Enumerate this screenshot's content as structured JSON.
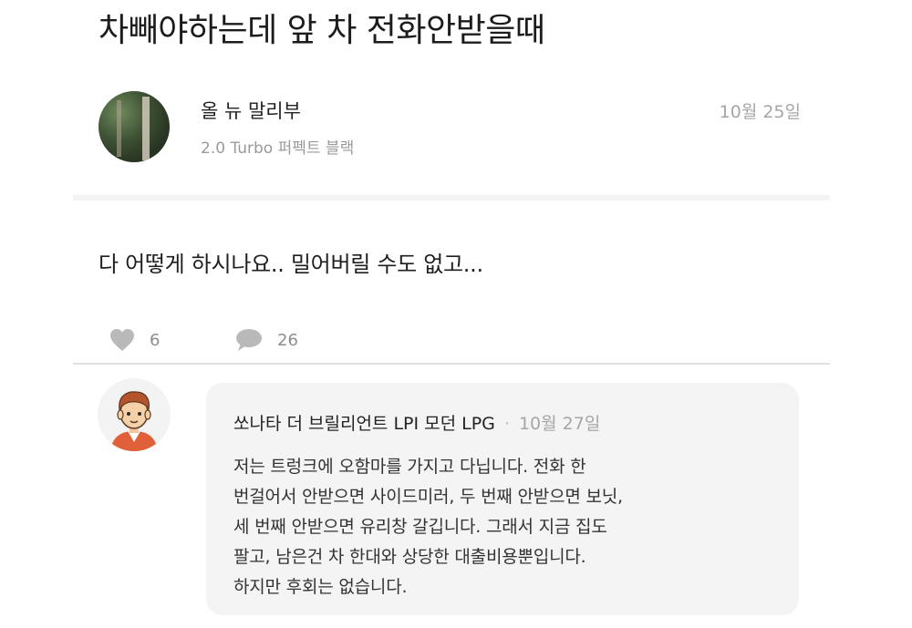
{
  "post": {
    "title": "차빼야하는데 앞 차 전화안받을때",
    "author": {
      "name": "올 뉴 말리부",
      "car": "2.0 Turbo 퍼펙트 블랙"
    },
    "date": "10월 25일",
    "body": "다 어떻게 하시나요.. 밀어버릴 수도 없고...",
    "likes": "6",
    "comments": "26"
  },
  "comment": {
    "author": "쏘나타 더 브릴리언트 LPI 모던 LPG",
    "separator": "·",
    "date": "10월 27일",
    "lines": [
      "저는 트렁크에 오함마를 가지고 다닙니다. 전화 한",
      "번걸어서 안받으면 사이드미러, 두 번째 안받으면 보닛,",
      "세 번째 안받으면 유리창 갈깁니다. 그래서 지금 집도",
      "팔고, 남은건 차 한대와 상당한 대출비용뿐입니다.",
      "하지만 후회는 없습니다."
    ]
  },
  "icons": {
    "like": "heart-icon",
    "comment": "speech-bubble-icon"
  },
  "colors": {
    "muted_text": "#a6a6a6",
    "bubble_bg": "#f4f4f4",
    "icon_gray": "#b9b9b9"
  }
}
